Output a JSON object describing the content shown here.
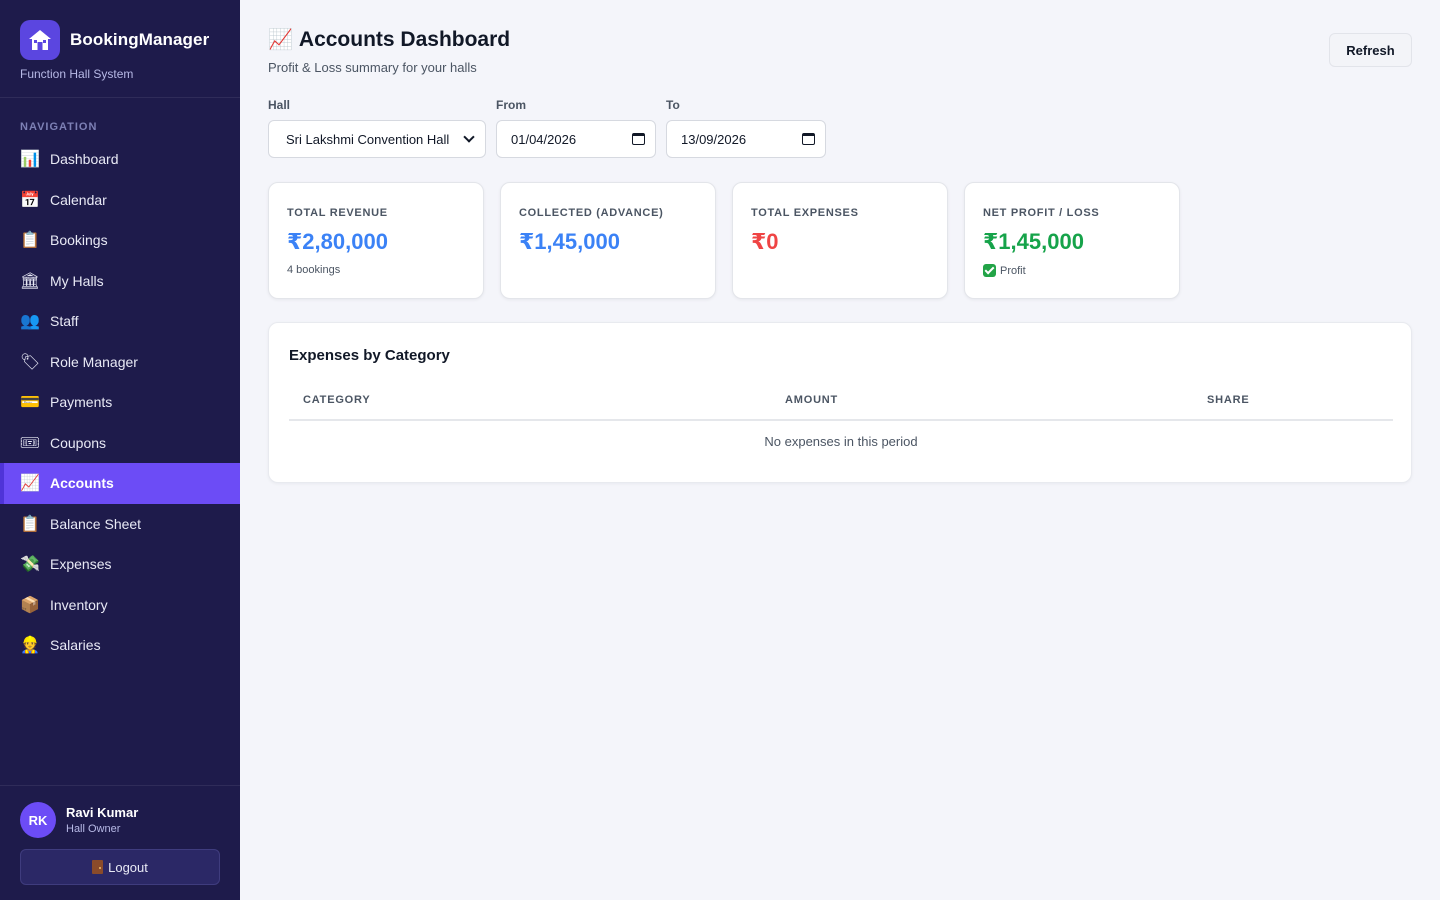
{
  "brand": {
    "name": "BookingManager",
    "subtitle": "Function Hall System"
  },
  "nav": {
    "heading": "NAVIGATION",
    "items": [
      {
        "label": "Dashboard",
        "icon": "📊",
        "icon_name": "bar-chart-icon"
      },
      {
        "label": "Calendar",
        "icon": "📅",
        "icon_name": "calendar-icon"
      },
      {
        "label": "Bookings",
        "icon": "📋",
        "icon_name": "clipboard-icon"
      },
      {
        "label": "My Halls",
        "icon": "🏛",
        "icon_name": "building-icon"
      },
      {
        "label": "Staff",
        "icon": "👥",
        "icon_name": "people-icon"
      },
      {
        "label": "Role Manager",
        "icon": "🏷",
        "icon_name": "tag-icon"
      },
      {
        "label": "Payments",
        "icon": "💳",
        "icon_name": "credit-card-icon"
      },
      {
        "label": "Coupons",
        "icon": "🎟",
        "icon_name": "ticket-icon"
      },
      {
        "label": "Accounts",
        "icon": "📈",
        "icon_name": "trend-chart-icon",
        "active": true
      },
      {
        "label": "Balance Sheet",
        "icon": "📋",
        "icon_name": "clipboard-icon"
      },
      {
        "label": "Expenses",
        "icon": "💸",
        "icon_name": "money-wings-icon"
      },
      {
        "label": "Inventory",
        "icon": "📦",
        "icon_name": "package-icon"
      },
      {
        "label": "Salaries",
        "icon": "👷",
        "icon_name": "worker-icon"
      }
    ]
  },
  "user": {
    "initials": "RK",
    "name": "Ravi Kumar",
    "role": "Hall Owner",
    "logout_label": "Logout"
  },
  "header": {
    "title_icon": "📈",
    "title": "Accounts Dashboard",
    "subtitle": "Profit & Loss summary for your halls",
    "refresh_label": "Refresh"
  },
  "filters": {
    "hall": {
      "label": "Hall",
      "value": "Sri Lakshmi Convention Hall"
    },
    "from": {
      "label": "From",
      "value": "01/04/2026"
    },
    "to": {
      "label": "To",
      "value": "13/09/2026"
    }
  },
  "cards": [
    {
      "label": "TOTAL REVENUE",
      "value": "₹2,80,000",
      "note": "4 bookings",
      "color": "#3b82f6"
    },
    {
      "label": "COLLECTED (ADVANCE)",
      "value": "₹1,45,000",
      "note": "",
      "color": "#3b82f6"
    },
    {
      "label": "TOTAL EXPENSES",
      "value": "₹0",
      "note": "",
      "color": "#ef4444"
    },
    {
      "label": "NET PROFIT / LOSS",
      "value": "₹1,45,000",
      "note": "Profit",
      "color": "#16a34a"
    }
  ],
  "expenses": {
    "title": "Expenses by Category",
    "columns": [
      "CATEGORY",
      "AMOUNT",
      "SHARE"
    ],
    "empty_text": "No expenses in this period"
  },
  "colors": {
    "sidebar_bg": "#1e1b4b",
    "accent": "#6c4cf6",
    "page_bg": "#f4f5fa"
  }
}
